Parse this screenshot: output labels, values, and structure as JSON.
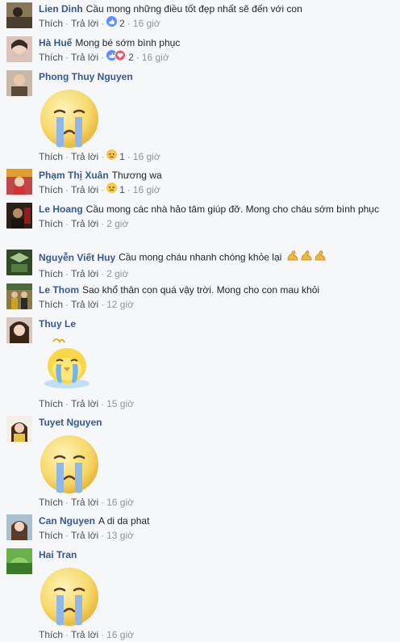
{
  "actions": {
    "like": "Thích",
    "reply": "Trả lời",
    "sep": "·"
  },
  "comments": [
    {
      "author": "Lien Dinh",
      "text": "Cầu mong những điều tốt đẹp nhất sẽ đến với con",
      "reactions": "like",
      "count": "2",
      "time": "16 giờ",
      "avatar_color": "#6b5a45"
    },
    {
      "author": "Hà Huế",
      "text": "Mong bé sớm bình phục",
      "reactions": "like-love",
      "count": "2",
      "time": "16 giờ",
      "avatar_color": "#c9a89a"
    },
    {
      "author": "Phong Thuy Nguyen",
      "text": "",
      "sticker": "crying-face",
      "time": "16 giờ",
      "count": "1",
      "reactions": "sad",
      "avatar_color": "#a58e7a"
    },
    {
      "author": "Phạm Thị Xuân",
      "text": "Thương wa",
      "reactions": "sad",
      "count": "1",
      "time": "16 giờ",
      "avatar_color": "#b23a3a"
    },
    {
      "author": "Le Hoang",
      "text": "Cầu mong các nhà hảo tâm giúp đỡ. Mong cho cháu sớm bình phục",
      "time": "2 giờ",
      "avatar_color": "#3a2d22"
    },
    {
      "author": "Nguyễn Viết Huy",
      "text": "Cầu mong cháu nhanh chóng khỏe lại",
      "emoji": "💪💪💪",
      "time": "2 giờ",
      "avatar_color": "#3d5a2e"
    },
    {
      "author": "Le Thom",
      "text": "Sao khổ thân con quá vậy trời. Mong cho con mau khỏi",
      "time": "12 giờ",
      "avatar_color": "#7a6a3a"
    },
    {
      "author": "Thuy Le",
      "text": "",
      "sticker": "crying-chick",
      "time": "15 giờ",
      "avatar_color": "#5a3b2e"
    },
    {
      "author": "Tuyet Nguyen",
      "text": "",
      "sticker": "crying-face",
      "time": "16 giờ",
      "avatar_color": "#e0c070"
    },
    {
      "author": "Can Nguyen",
      "text": "A di da phat",
      "time": "13 giờ",
      "avatar_color": "#7a9ab0"
    },
    {
      "author": "Hai Tran",
      "text": "",
      "sticker": "crying-face",
      "time": "16 giờ",
      "avatar_color": "#3e8e3e"
    }
  ]
}
